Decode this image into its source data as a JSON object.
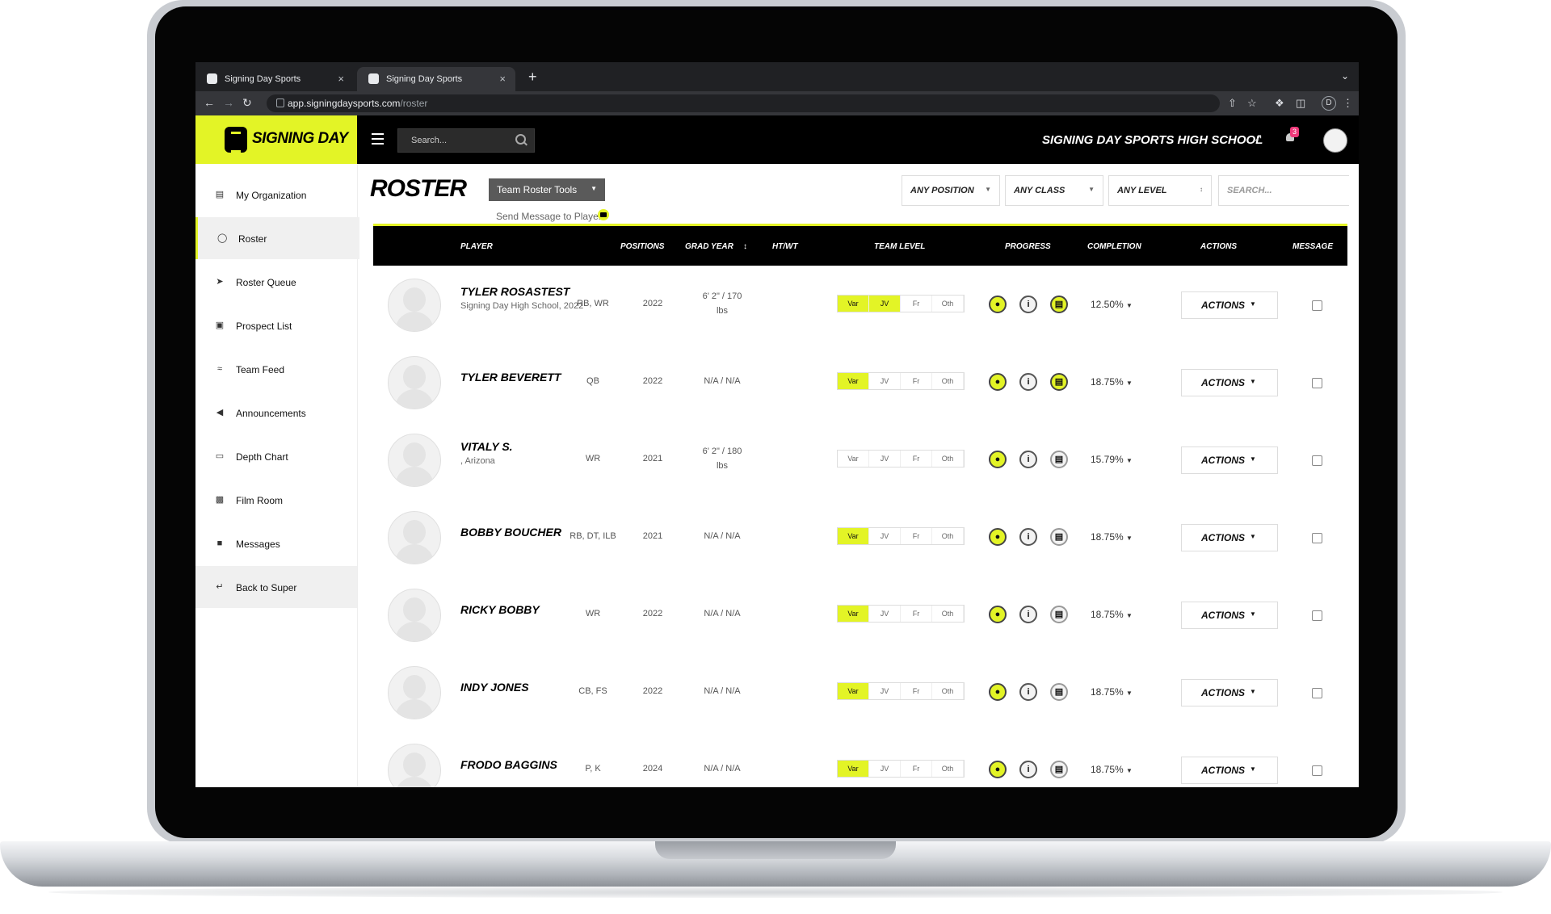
{
  "browser": {
    "tabs": [
      {
        "title": "Signing Day Sports",
        "close": "×"
      },
      {
        "title": "Signing Day Sports",
        "close": "×"
      }
    ],
    "new_tab": "+",
    "url_domain": "app.signingdaysports.com",
    "url_path": "/roster",
    "profile_initial": "D"
  },
  "app": {
    "logo_text": "SIGNING DAY",
    "search_placeholder": "Search...",
    "school_name": "SIGNING DAY SPORTS HIGH SCHOOL",
    "notification_count": "3"
  },
  "sidebar": {
    "items": [
      {
        "label": "My Organization",
        "icon": "building-icon"
      },
      {
        "label": "Roster",
        "icon": "user-icon"
      },
      {
        "label": "Roster Queue",
        "icon": "arrow-circle-icon"
      },
      {
        "label": "Prospect List",
        "icon": "list-icon"
      },
      {
        "label": "Team Feed",
        "icon": "rss-icon"
      },
      {
        "label": "Announcements",
        "icon": "megaphone-icon"
      },
      {
        "label": "Depth Chart",
        "icon": "monitor-icon"
      },
      {
        "label": "Film Room",
        "icon": "film-icon"
      },
      {
        "label": "Messages",
        "icon": "message-icon"
      },
      {
        "label": "Back to Super",
        "icon": "return-icon"
      }
    ]
  },
  "main": {
    "title": "ROSTER",
    "tools_label": "Team Roster Tools",
    "send_message": "Send Message to Players",
    "filters": {
      "position": "ANY POSITION",
      "class": "ANY CLASS",
      "level": "ANY LEVEL",
      "search_placeholder": "SEARCH..."
    }
  },
  "table": {
    "headers": {
      "player": "PLAYER",
      "positions": "POSITIONS",
      "grad_year": "GRAD YEAR",
      "htwt": "HT/WT",
      "team_level": "TEAM LEVEL",
      "progress": "PROGRESS",
      "completion": "COMPLETION",
      "actions": "ACTIONS",
      "message": "MESSAGE"
    },
    "level_labels": [
      "Var",
      "JV",
      "Fr",
      "Oth"
    ],
    "actions_label": "ACTIONS",
    "rows": [
      {
        "name": "TYLER ROSASTEST",
        "sub": "Signing Day High School, 2022",
        "positions": "RB, WR",
        "grad_year": "2022",
        "htwt_1": "6' 2\" / 170",
        "htwt_2": "lbs",
        "levels_on": [
          true,
          true,
          false,
          false
        ],
        "film_on": true,
        "completion": "12.50%"
      },
      {
        "name": "TYLER BEVERETT",
        "sub": "",
        "positions": "QB",
        "grad_year": "2022",
        "htwt_1": "N/A / N/A",
        "htwt_2": "",
        "levels_on": [
          true,
          false,
          false,
          false
        ],
        "film_on": true,
        "completion": "18.75%"
      },
      {
        "name": "VITALY S.",
        "sub": ", Arizona",
        "positions": "WR",
        "grad_year": "2021",
        "htwt_1": "6' 2\" / 180",
        "htwt_2": "lbs",
        "levels_on": [
          false,
          false,
          false,
          false
        ],
        "film_on": false,
        "completion": "15.79%"
      },
      {
        "name": "BOBBY BOUCHER",
        "sub": "",
        "positions": "RB, DT, ILB",
        "grad_year": "2021",
        "htwt_1": "N/A / N/A",
        "htwt_2": "",
        "levels_on": [
          true,
          false,
          false,
          false
        ],
        "film_on": false,
        "completion": "18.75%"
      },
      {
        "name": "RICKY BOBBY",
        "sub": "",
        "positions": "WR",
        "grad_year": "2022",
        "htwt_1": "N/A / N/A",
        "htwt_2": "",
        "levels_on": [
          true,
          false,
          false,
          false
        ],
        "film_on": false,
        "completion": "18.75%"
      },
      {
        "name": "INDY JONES",
        "sub": "",
        "positions": "CB, FS",
        "grad_year": "2022",
        "htwt_1": "N/A / N/A",
        "htwt_2": "",
        "levels_on": [
          true,
          false,
          false,
          false
        ],
        "film_on": false,
        "completion": "18.75%"
      },
      {
        "name": "FRODO BAGGINS",
        "sub": "",
        "positions": "P, K",
        "grad_year": "2024",
        "htwt_1": "N/A / N/A",
        "htwt_2": "",
        "levels_on": [
          true,
          false,
          false,
          false
        ],
        "film_on": false,
        "completion": "18.75%"
      }
    ]
  },
  "colors": {
    "accent": "#e3f426",
    "header_bg": "#000000",
    "badge": "#f0397a"
  }
}
